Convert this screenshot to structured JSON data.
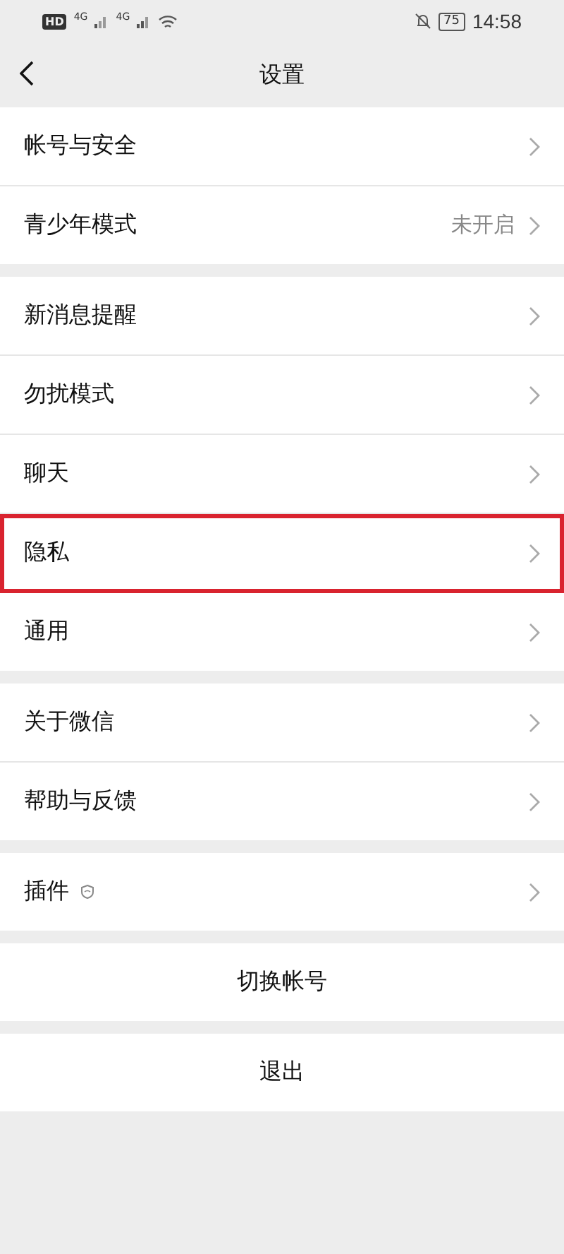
{
  "status_bar": {
    "hd": "HD",
    "signal_1": "4G",
    "signal_2": "4G",
    "battery": "75",
    "time": "14:58"
  },
  "header": {
    "title": "设置"
  },
  "groups": [
    [
      {
        "label": "帐号与安全",
        "highlighted": false,
        "has_icon": false
      },
      {
        "label": "青少年模式",
        "value": "未开启",
        "highlighted": false,
        "has_icon": false
      }
    ],
    [
      {
        "label": "新消息提醒",
        "highlighted": false,
        "has_icon": false
      },
      {
        "label": "勿扰模式",
        "highlighted": false,
        "has_icon": false
      },
      {
        "label": "聊天",
        "highlighted": false,
        "has_icon": false
      },
      {
        "label": "隐私",
        "highlighted": true,
        "has_icon": false
      },
      {
        "label": "通用",
        "highlighted": false,
        "has_icon": false
      }
    ],
    [
      {
        "label": "关于微信",
        "highlighted": false,
        "has_icon": false
      },
      {
        "label": "帮助与反馈",
        "highlighted": false,
        "has_icon": false
      }
    ],
    [
      {
        "label": "插件",
        "highlighted": false,
        "has_icon": true
      }
    ]
  ],
  "buttons": [
    "切换帐号",
    "退出"
  ]
}
